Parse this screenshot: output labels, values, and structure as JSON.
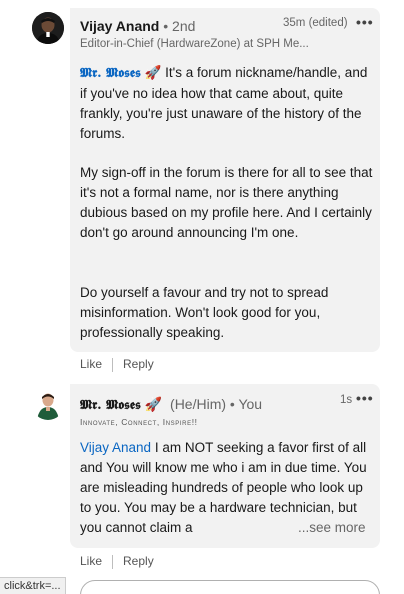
{
  "comment1": {
    "author": "Vijay Anand",
    "degree": "• 2nd",
    "headline": "Editor-in-Chief (HardwareZone) at SPH Me...",
    "time": "35m (edited)",
    "mention": "𝕸𝖗. 𝕸𝖔𝖘𝖊𝖘",
    "mention_icon": "🚀",
    "text_after_mention": " It's a forum nickname/handle, and if you've no idea how that came about, quite frankly, you're just unaware of the history of the forums.",
    "para2": "My sign-off in the forum is there for all to see that it's not a formal name, nor is there anything dubious based on my profile here. And I certainly don't go around announcing I'm one.",
    "para3": "Do yourself a favour and try not to spread misinformation. Won't look good for you, professionally speaking.",
    "like": "Like",
    "reply": "Reply"
  },
  "comment2": {
    "author": "𝕸𝖗. 𝕸𝖔𝖘𝖊𝖘",
    "author_icon": "🚀",
    "pronouns": "(He/Him)",
    "you_badge": "• You",
    "tagline": "Innovate, Connect, Inspire!!",
    "time": "1s",
    "mention": "Vijay Anand",
    "text_after_mention": " I am NOT seeking a favor first of all and You will know me who i am in due time. You are misleading hundreds of people who look up to you. You may be a hardware technician, but you cannot claim a",
    "see_more": "...see more",
    "like": "Like",
    "reply": "Reply"
  },
  "more_label": "•••",
  "status_url": "click&trk=..."
}
